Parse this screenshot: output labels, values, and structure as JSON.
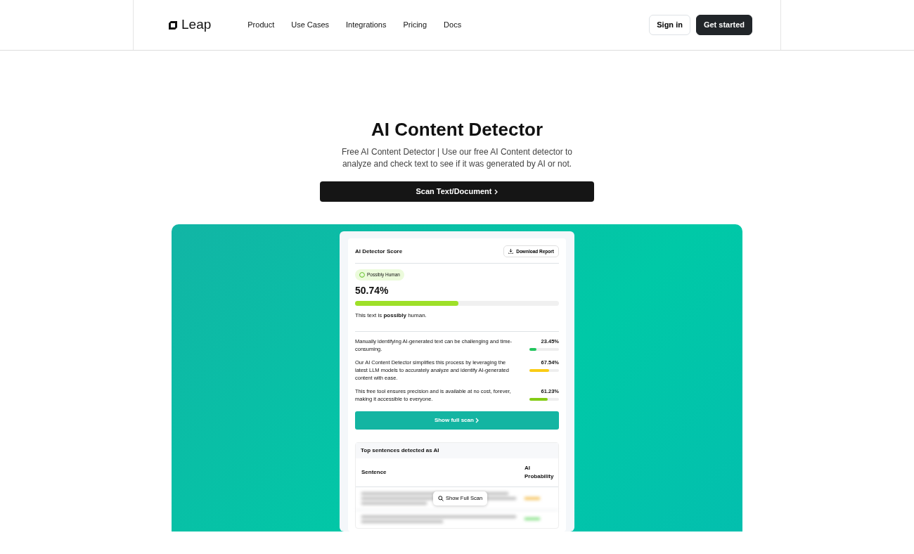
{
  "nav": {
    "logo": "Leap",
    "links": [
      "Product",
      "Use Cases",
      "Integrations",
      "Pricing",
      "Docs"
    ],
    "sign_in": "Sign in",
    "get_started": "Get started"
  },
  "hero": {
    "title": "AI Content Detector",
    "subtitle": "Free AI Content Detector | Use our free AI Content detector to analyze and check text to see if it was generated by AI or not.",
    "button": "Scan Text/Document"
  },
  "score_card": {
    "title": "AI Detector Score",
    "download": "Download Report",
    "badge": "Possibly Human",
    "score": "50.74%",
    "level": 0.5074,
    "verdict": "This text is **possibly** human.",
    "sentences": [
      {
        "text": "Manually identifying AI-generated text can be challenging and time-consuming.",
        "reading": "23.45%",
        "level": 0.2345,
        "color": "#22c55e"
      },
      {
        "text": "Our AI Content Detector simplifies this process by leveraging the latest LLM models to accurately analyze and identify AI-generated content with ease.",
        "reading": "67.54%",
        "level": 0.6754,
        "color": "#facc15"
      },
      {
        "text": "This free tool ensures precision and is available at no cost, forever, making it accessible to everyone.",
        "reading": "61.23%",
        "level": 0.6123,
        "color": "#84cc16"
      }
    ],
    "show_button": "Show full scan",
    "table": {
      "title": "Top sentences detected as AI",
      "columns": [
        "Sentence",
        "AI Probability"
      ],
      "overlay_button": "Show Full Scan"
    }
  }
}
